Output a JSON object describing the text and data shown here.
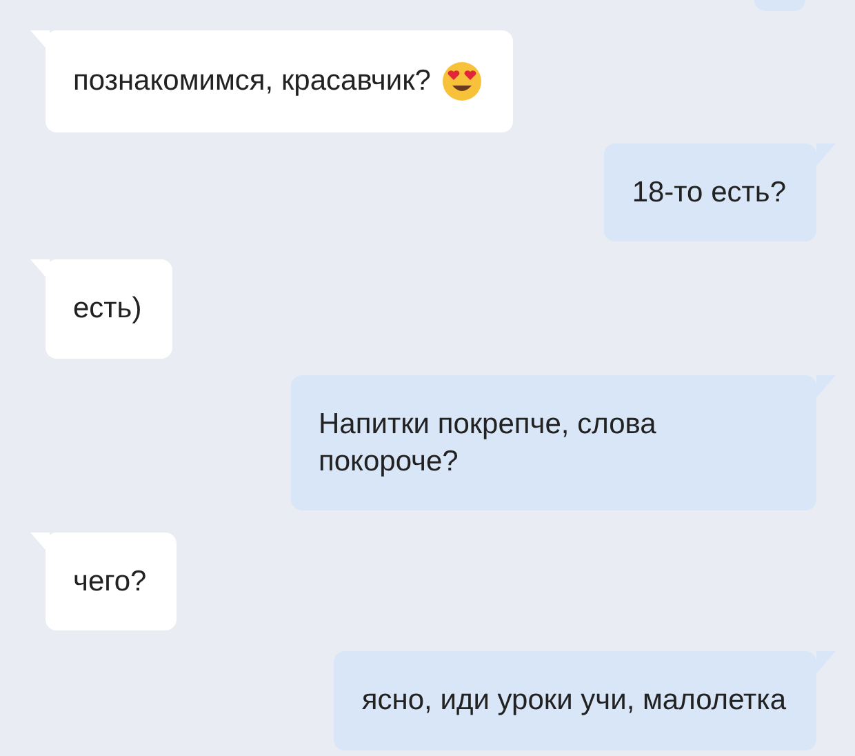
{
  "messages": [
    {
      "kind": "outgoing_partial"
    },
    {
      "kind": "incoming",
      "text": "познакомимся, красавчик?",
      "trailing_icon": true
    },
    {
      "kind": "outgoing",
      "text": "18-то есть?"
    },
    {
      "kind": "incoming",
      "text": "есть)"
    },
    {
      "kind": "outgoing",
      "text": "Напитки покрепче, слова покороче?"
    },
    {
      "kind": "incoming",
      "text": "чего?"
    },
    {
      "kind": "outgoing",
      "text": "ясно, иди уроки учи, малолетка"
    }
  ]
}
